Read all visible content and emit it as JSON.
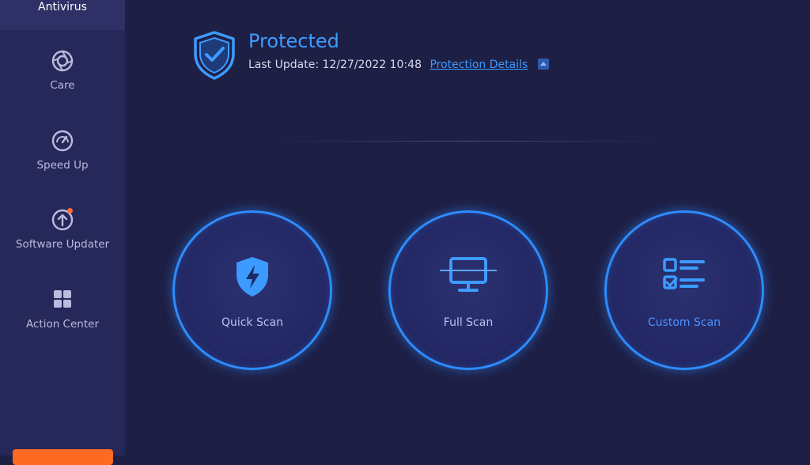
{
  "sidebar": {
    "active": {
      "label": "Antivirus"
    },
    "items": [
      {
        "label": "Care",
        "icon": "aperture-icon"
      },
      {
        "label": "Speed Up",
        "icon": "gauge-icon"
      },
      {
        "label": "Software Updater",
        "icon": "upload-arrow-icon",
        "badge": true
      },
      {
        "label": "Action Center",
        "icon": "grid-icon"
      }
    ]
  },
  "status": {
    "title": "Protected",
    "last_update_label": "Last Update:",
    "last_update_value": "12/27/2022 10:48",
    "details_link": "Protection Details",
    "icon": "shield-check-icon"
  },
  "scans": [
    {
      "label": "Quick Scan",
      "icon": "shield-bolt-icon"
    },
    {
      "label": "Full Scan",
      "icon": "monitor-icon"
    },
    {
      "label": "Custom Scan",
      "icon": "checklist-icon"
    }
  ],
  "colors": {
    "accent": "#3d9bff",
    "ring": "#2d8cff",
    "background": "#1e1f45",
    "sidebar": "#26285a",
    "badge": "#ff6a3a",
    "orange_button": "#ff6a22"
  }
}
